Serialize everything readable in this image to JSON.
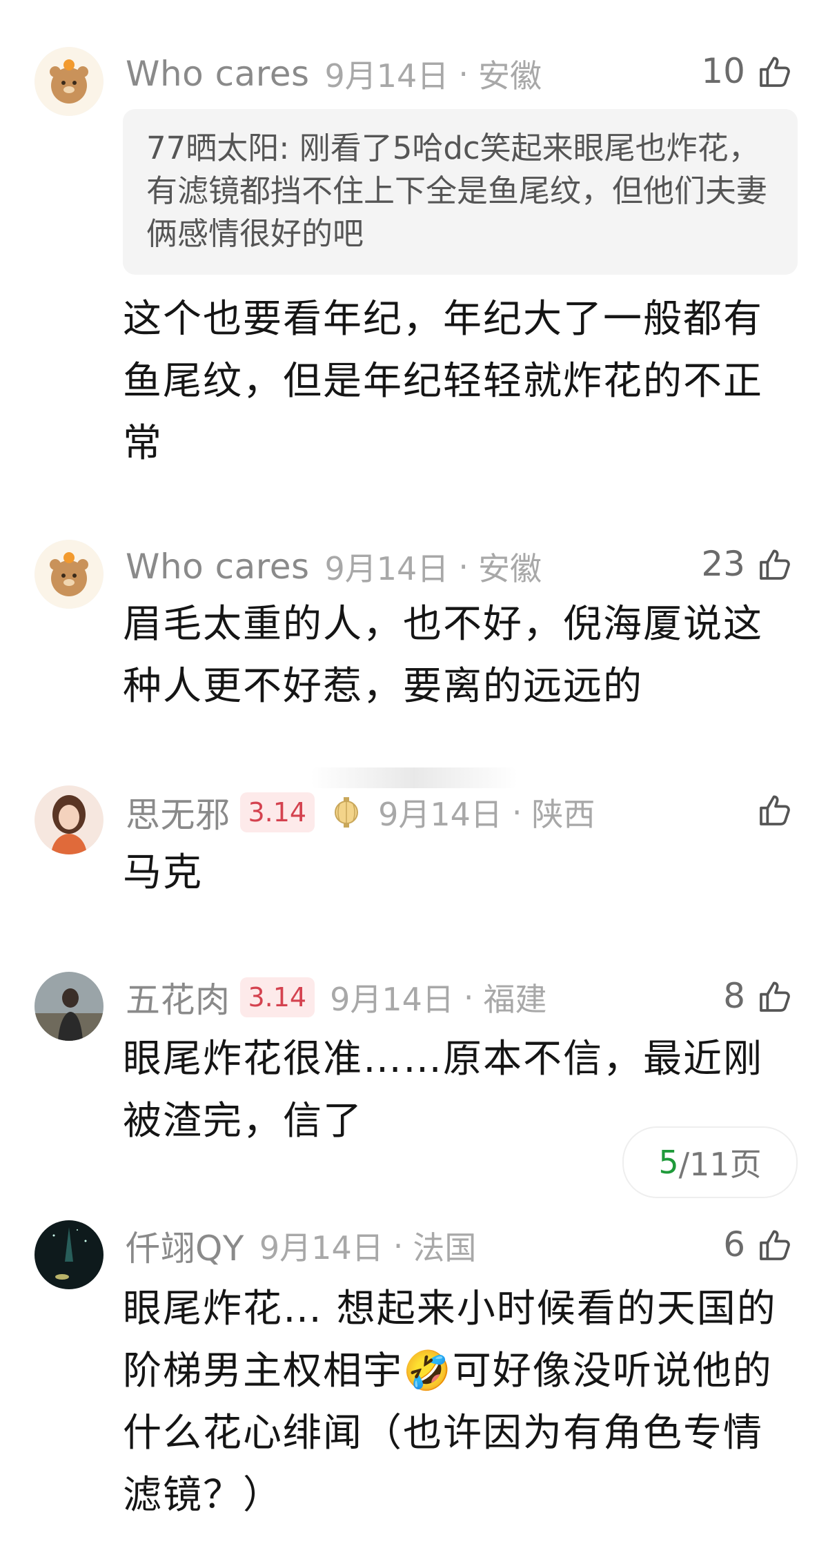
{
  "comments": [
    {
      "username": "Who cares",
      "date": "9月14日",
      "location": "安徽",
      "likes": "10",
      "quote": "77晒太阳: 刚看了5哈dc笑起来眼尾也炸花，有滤镜都挡不住上下全是鱼尾纹，但他们夫妻俩感情很好的吧",
      "text": "这个也要看年纪，年纪大了一般都有鱼尾纹，但是年纪轻轻就炸花的不正常"
    },
    {
      "username": "Who cares",
      "date": "9月14日",
      "location": "安徽",
      "likes": "23",
      "text": "眉毛太重的人，也不好，倪海厦说这种人更不好惹，要离的远远的"
    },
    {
      "username": "思无邪",
      "badge": "3.14",
      "date": "9月14日",
      "location": "陕西",
      "likes": "",
      "text": "马克"
    },
    {
      "username": "五花肉",
      "badge": "3.14",
      "date": "9月14日",
      "location": "福建",
      "likes": "8",
      "text": "眼尾炸花很准……原本不信，最近刚被渣完，信了"
    },
    {
      "username": "仟翊QY",
      "date": "9月14日",
      "location": "法国",
      "likes": "6",
      "text": "眼尾炸花… 想起来小时候看的天国的阶梯男主权相宇🤣可好像没听说他的什么花心绯闻（也许因为有角色专情滤镜？）"
    }
  ],
  "pager": {
    "current": "5",
    "rest": "/11页"
  },
  "separator": "·",
  "icons": {
    "like": "thumbs-up-icon",
    "lantern": "lantern-icon"
  },
  "colors": {
    "badge_text": "#d4424f",
    "badge_bg": "#fdeaea",
    "pager_current": "#1f9a3a"
  }
}
